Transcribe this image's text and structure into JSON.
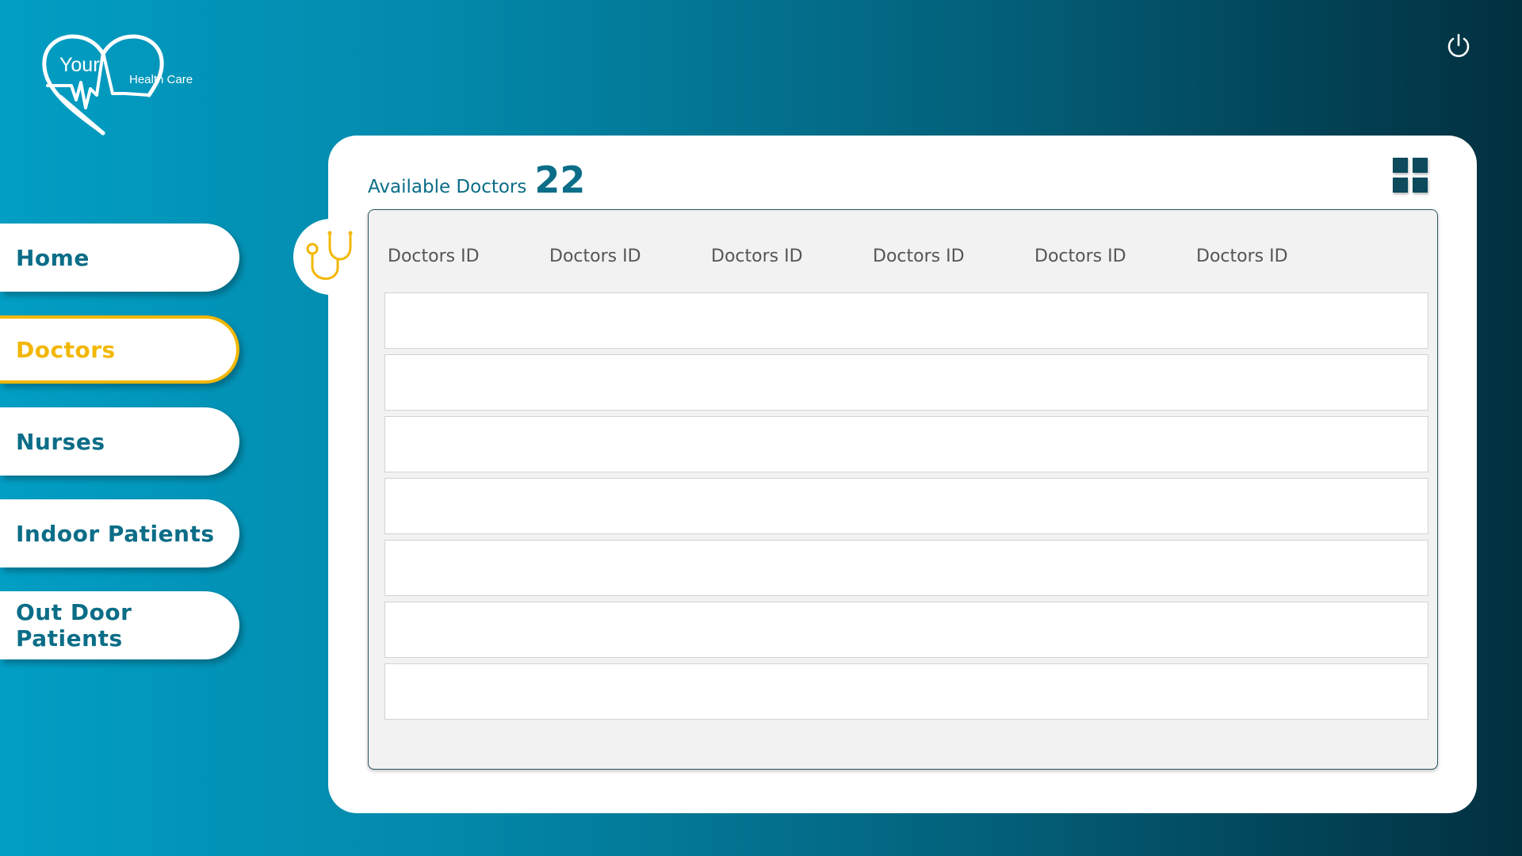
{
  "logo": {
    "line1": "Your",
    "line2": "Health Care"
  },
  "nav": {
    "items": [
      {
        "label": "Home",
        "active": false
      },
      {
        "label": "Doctors",
        "active": true
      },
      {
        "label": "Nurses",
        "active": false
      },
      {
        "label": "Indoor Patients",
        "active": false
      },
      {
        "label": "Out Door Patients",
        "active": false
      }
    ]
  },
  "panel": {
    "title": "Available Doctors",
    "count": "22",
    "columns": [
      "Doctors ID",
      "Doctors ID",
      "Doctors ID",
      "Doctors ID",
      "Doctors ID",
      "Doctors ID"
    ],
    "row_count": 7
  },
  "icons": {
    "logo": "heart-pulse-logo-icon",
    "power": "power-icon",
    "view": "grid-view-icon",
    "section": "stethoscope-icon"
  },
  "colors": {
    "accent": "#f2b705",
    "primary": "#0b6d87",
    "dark": "#0c4a5c",
    "background_start": "#029ec4",
    "background_end": "#02303f"
  }
}
